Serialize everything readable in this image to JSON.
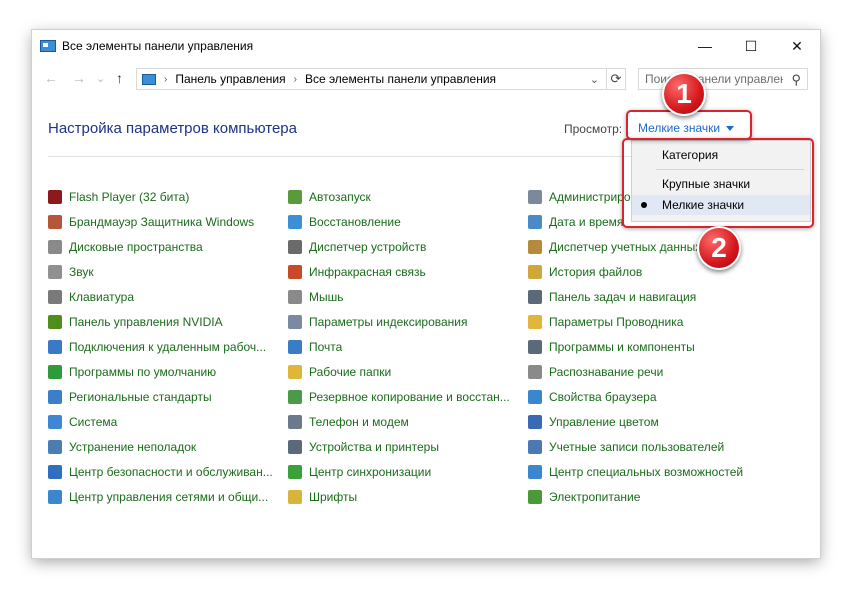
{
  "window": {
    "title": "Все элементы панели управления",
    "minimize": "—",
    "maximize": "☐",
    "close": "✕"
  },
  "nav": {
    "back": "←",
    "forward": "→",
    "recent": "⌄",
    "up": "↑"
  },
  "address": {
    "crumbs": [
      "Панель управления",
      "Все элементы панели управления"
    ],
    "dropdown_arrow": "⌄",
    "refresh": "⟳"
  },
  "search": {
    "placeholder": "Поиск в панели управления",
    "icon": "⚲"
  },
  "heading": "Настройка параметров компьютера",
  "view": {
    "label": "Просмотр:",
    "value": "Мелкие значки"
  },
  "view_menu": {
    "items": [
      {
        "label": "Категория",
        "selected": false
      },
      {
        "label": "Крупные значки",
        "selected": false
      },
      {
        "label": "Мелкие значки",
        "selected": true
      }
    ]
  },
  "badges": [
    "1",
    "2"
  ],
  "columns": [
    [
      {
        "label": "Flash Player (32 бита)",
        "icon": "flash-icon",
        "color": "#8b1a1a"
      },
      {
        "label": "Брандмауэр Защитника Windows",
        "icon": "firewall-icon",
        "color": "#b5563a"
      },
      {
        "label": "Дисковые пространства",
        "icon": "disk-spaces-icon",
        "color": "#8a8a8a"
      },
      {
        "label": "Звук",
        "icon": "speaker-icon",
        "color": "#909090"
      },
      {
        "label": "Клавиатура",
        "icon": "keyboard-icon",
        "color": "#7a7a7a"
      },
      {
        "label": "Панель управления NVIDIA",
        "icon": "nvidia-icon",
        "color": "#4d8f1a"
      },
      {
        "label": "Подключения к удаленным рабоч...",
        "icon": "remote-desktop-icon",
        "color": "#3c78c8"
      },
      {
        "label": "Программы по умолчанию",
        "icon": "default-programs-icon",
        "color": "#2f9a3c"
      },
      {
        "label": "Региональные стандарты",
        "icon": "region-icon",
        "color": "#3b7fc9"
      },
      {
        "label": "Система",
        "icon": "system-icon",
        "color": "#3f86d6"
      },
      {
        "label": "Устранение неполадок",
        "icon": "troubleshoot-icon",
        "color": "#4b7db5"
      },
      {
        "label": "Центр безопасности и обслуживан...",
        "icon": "security-flag-icon",
        "color": "#2e6fc1"
      },
      {
        "label": "Центр управления сетями и общи...",
        "icon": "network-icon",
        "color": "#3a86cf"
      }
    ],
    [
      {
        "label": "Автозапуск",
        "icon": "autoplay-icon",
        "color": "#5a9a3a"
      },
      {
        "label": "Восстановление",
        "icon": "recovery-icon",
        "color": "#3b8fd6"
      },
      {
        "label": "Диспетчер устройств",
        "icon": "device-manager-icon",
        "color": "#6a6a6a"
      },
      {
        "label": "Инфракрасная связь",
        "icon": "infrared-icon",
        "color": "#c84a2a"
      },
      {
        "label": "Мышь",
        "icon": "mouse-icon",
        "color": "#8a8a8a"
      },
      {
        "label": "Параметры индексирования",
        "icon": "indexing-icon",
        "color": "#7a8aa0"
      },
      {
        "label": "Почта",
        "icon": "mail-icon",
        "color": "#3a7dc4"
      },
      {
        "label": "Рабочие папки",
        "icon": "work-folders-icon",
        "color": "#e0b63a"
      },
      {
        "label": "Резервное копирование и восстан...",
        "icon": "backup-icon",
        "color": "#4a9a4a"
      },
      {
        "label": "Телефон и модем",
        "icon": "phone-modem-icon",
        "color": "#6a7a8a"
      },
      {
        "label": "Устройства и принтеры",
        "icon": "printer-icon",
        "color": "#5a6a7a"
      },
      {
        "label": "Центр синхронизации",
        "icon": "sync-icon",
        "color": "#3aa03a"
      },
      {
        "label": "Шрифты",
        "icon": "fonts-icon",
        "color": "#d9b43a"
      }
    ],
    [
      {
        "label": "Администрирование",
        "icon": "admin-tools-icon",
        "color": "#7a8a9a"
      },
      {
        "label": "Дата и время",
        "icon": "clock-icon",
        "color": "#4a8ac8"
      },
      {
        "label": "Диспетчер учетных данных",
        "icon": "credential-icon",
        "color": "#b58a3a"
      },
      {
        "label": "История файлов",
        "icon": "file-history-icon",
        "color": "#d0a83a"
      },
      {
        "label": "Панель задач и навигация",
        "icon": "taskbar-icon",
        "color": "#5a6a7a"
      },
      {
        "label": "Параметры Проводника",
        "icon": "explorer-options-icon",
        "color": "#e0b63a"
      },
      {
        "label": "Программы и компоненты",
        "icon": "programs-icon",
        "color": "#5a6a7a"
      },
      {
        "label": "Распознавание речи",
        "icon": "microphone-icon",
        "color": "#8a8a8a"
      },
      {
        "label": "Свойства браузера",
        "icon": "internet-options-icon",
        "color": "#3a86cf"
      },
      {
        "label": "Управление цветом",
        "icon": "color-management-icon",
        "color": "#3a6ab5"
      },
      {
        "label": "Учетные записи пользователей",
        "icon": "users-icon",
        "color": "#4a7ab5"
      },
      {
        "label": "Центр специальных возможностей",
        "icon": "accessibility-icon",
        "color": "#3a86cf"
      },
      {
        "label": "Электропитание",
        "icon": "power-icon",
        "color": "#4a9a3a"
      }
    ]
  ]
}
